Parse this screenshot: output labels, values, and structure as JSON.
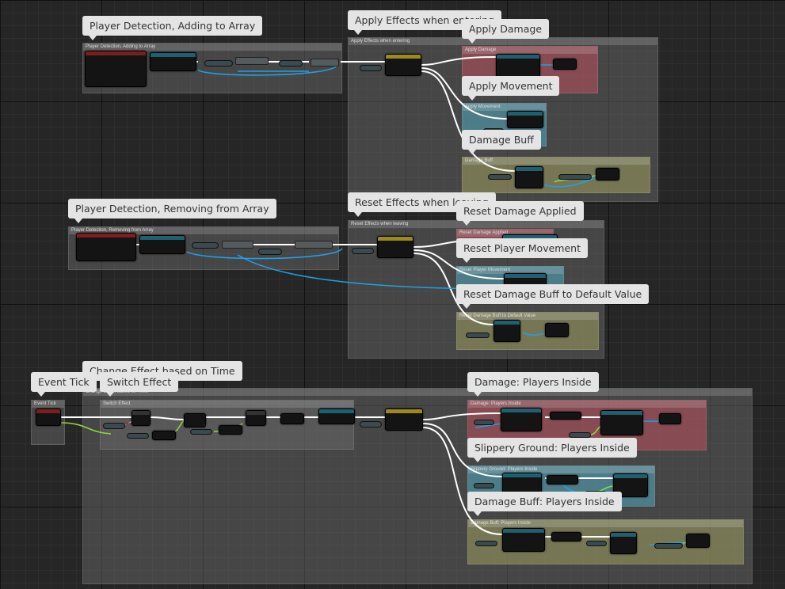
{
  "comments": {
    "player_detection_adding": "Player Detection, Adding to Array",
    "apply_effects_entering": "Apply Effects when entering",
    "apply_damage": "Apply Damage",
    "apply_movement": "Apply Movement",
    "damage_buff": "Damage Buff",
    "player_detection_removing": "Player Detection, Removing from Array",
    "reset_effects_leaving": "Reset Effects when leaving",
    "reset_damage_applied": "Reset Damage Applied",
    "reset_player_movement": "Reset Player Movement",
    "reset_damage_buff_default": "Reset Damage Buff to Default Value",
    "change_effect_time": "Change Effect based on Time",
    "event_tick": "Event Tick",
    "switch_effect": "Switch Effect",
    "damage_players_inside": "Damage: Players Inside",
    "slippery_ground_players_inside": "Slippery Ground: Players Inside",
    "damage_buff_players_inside": "Damage Buff: Players Inside"
  },
  "colors": {
    "grid": "#262626",
    "exec_wire": "#ffffff",
    "object_wire": "#1ea0e6",
    "bool_wire": "#8ed63a",
    "red_comment": "#be505f",
    "teal_comment": "#50a0b4",
    "olive_comment": "#96965f"
  }
}
